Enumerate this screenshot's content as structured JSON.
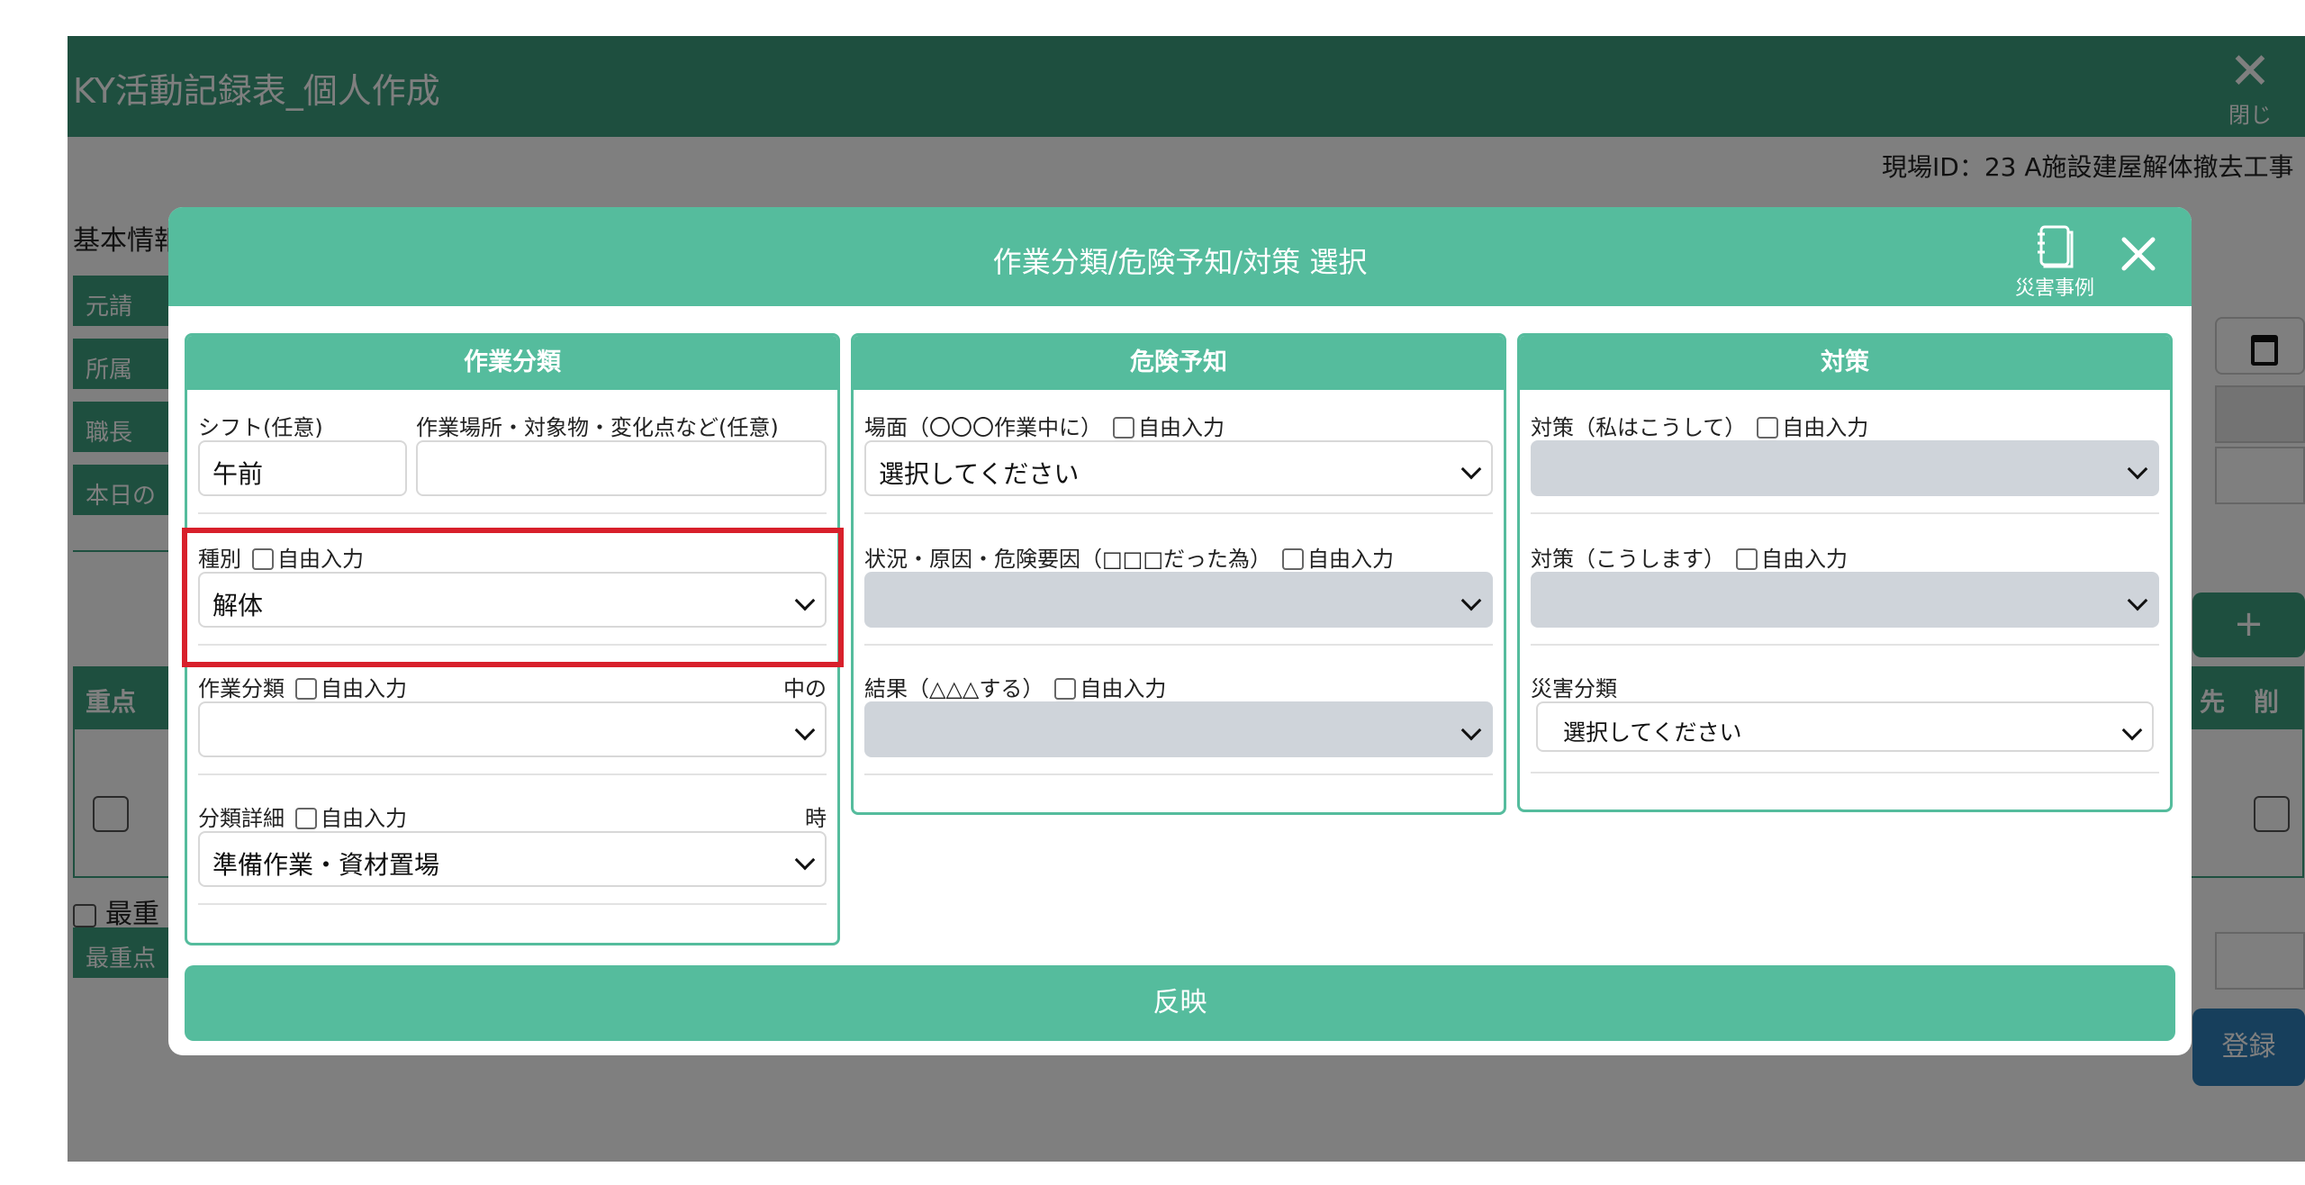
{
  "app": {
    "title": "KY活動記録表_個人作成",
    "close_label": "閉じる",
    "site_id": "現場ID：23 A施設建屋解体撤去工事",
    "basic_info": "基本情報",
    "side_labels": [
      "元請",
      "所属",
      "職長",
      "本日の"
    ],
    "table_headers_left": [
      "重点"
    ],
    "table_headers_right": [
      "先",
      "削"
    ],
    "most_important_check": "最重",
    "most_important_label": "最重点",
    "plus": "+",
    "register": "登録"
  },
  "modal": {
    "title": "作業分類/危険予知/対策 選択",
    "disaster_examples_label": "災害事例",
    "free_input": "自由入力",
    "apply_label": "反映",
    "panels": {
      "work": {
        "title": "作業分類",
        "shift_label": "シフト(任意)",
        "shift_value": "午前",
        "place_label": "作業場所・対象物・変化点など(任意)",
        "place_value": "",
        "type_label": "種別",
        "type_value": "解体",
        "category_label": "作業分類",
        "category_right": "中の",
        "category_value": "",
        "detail_label": "分類詳細",
        "detail_right": "時",
        "detail_value": "準備作業・資材置場"
      },
      "danger": {
        "title": "危険予知",
        "scene_label": "場面（〇〇〇作業中に）",
        "scene_value": "選択してください",
        "cause_label": "状況・原因・危険要因（□□□だった為）",
        "cause_value": "",
        "result_label": "結果（△△△する）",
        "result_value": ""
      },
      "measure": {
        "title": "対策",
        "me_label": "対策（私はこうして）",
        "me_value": "",
        "we_label": "対策（こうします）",
        "we_value": "",
        "disaster_label": "災害分類",
        "disaster_value": "選択してください"
      }
    }
  },
  "colors": {
    "accent": "#55bc9d",
    "app_header": "#3c9f7f",
    "highlight": "#d8202b",
    "disabled_select": "#cfd4da"
  }
}
